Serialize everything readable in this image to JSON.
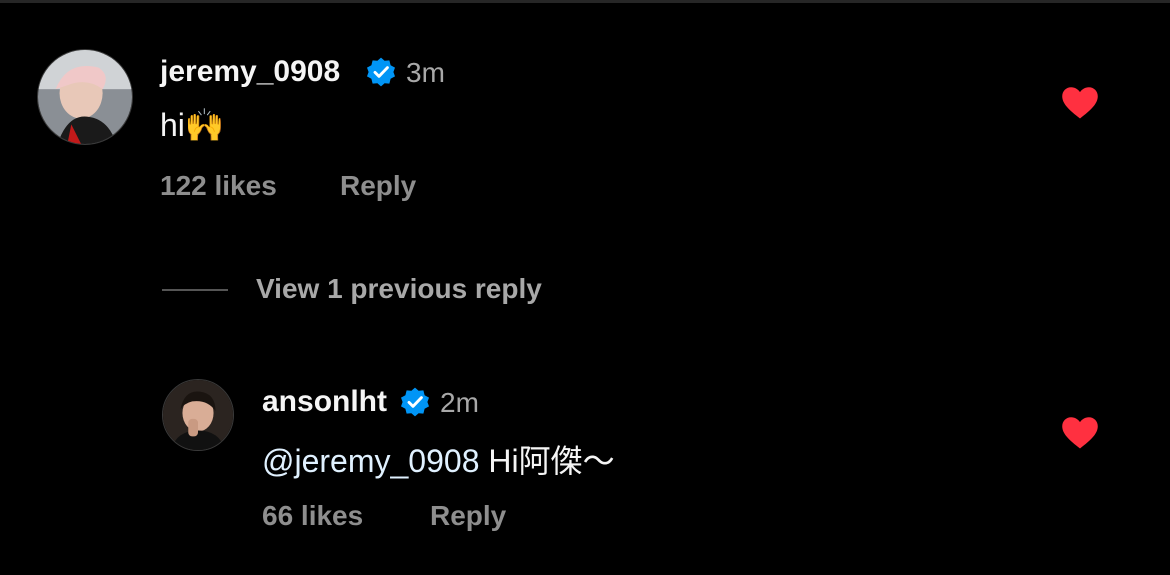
{
  "comment": {
    "username": "jeremy_0908",
    "time": "3m",
    "text": "hi🙌",
    "likes": "122 likes",
    "reply_label": "Reply",
    "liked": true
  },
  "view_previous": "View 1 previous reply",
  "reply": {
    "username": "ansonlht",
    "time": "2m",
    "mention": "@jeremy_0908",
    "text": " Hi阿傑～",
    "likes": "66 likes",
    "reply_label": "Reply",
    "liked": true
  },
  "colors": {
    "heart": "#ff3040",
    "verified": "#0095f6",
    "background": "#000000"
  },
  "icons": [
    "verified-badge-icon",
    "heart-icon"
  ]
}
